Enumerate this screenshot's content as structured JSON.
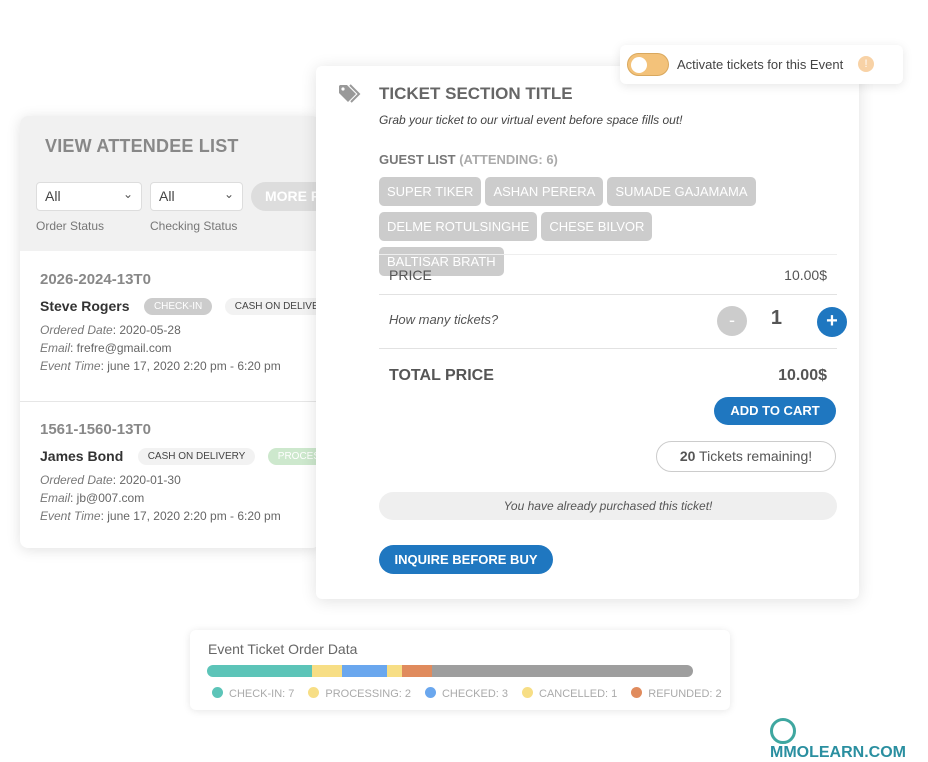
{
  "attendee_list": {
    "title": "VIEW ATTENDEE LIST",
    "filters": [
      {
        "value": "All",
        "label": "Order Status"
      },
      {
        "value": "All",
        "label": "Checking Status"
      }
    ],
    "more_button": "MORE F",
    "entries": [
      {
        "id": "2026-2024-13T0",
        "name": "Steve Rogers",
        "badges": [
          "CHECK-IN",
          "CASH ON DELIVER"
        ],
        "ordered_label": "Ordered Date",
        "ordered": ": 2020-05-28",
        "email_label": "Email",
        "email": ": frefre@gmail.com",
        "time_label": "Event Time",
        "time": ": june 17, 2020 2:20 pm - 6:20 pm"
      },
      {
        "id": "1561-1560-13T0",
        "name": "James Bond",
        "badges": [
          "CASH ON DELIVERY",
          "PROCESSI"
        ],
        "ordered_label": "Ordered Date",
        "ordered": ": 2020-01-30",
        "email_label": "Email",
        "email": ": jb@007.com",
        "time_label": "Event Time",
        "time": ": june 17, 2020 2:20 pm - 6:20 pm"
      }
    ]
  },
  "toggle": {
    "label": "Activate tickets for this Event",
    "on": true,
    "color": "#f3c27a"
  },
  "ticket": {
    "icon": "tags-icon",
    "title": "TICKET SECTION TITLE",
    "subtitle": "Grab your ticket to our virtual event before space fills out!",
    "guest_label": "GUEST LIST",
    "attending": "(ATTENDING: 6)",
    "guests": [
      "SUPER TIKER",
      "ASHAN PERERA",
      "SUMADE GAJAMAMA",
      "DELME ROTULSINGHE",
      "CHESE BILVOR",
      "BALTISAR BRATH"
    ],
    "price_label": "PRICE",
    "price": "10.00$",
    "qty_label": "How many tickets?",
    "qty": "1",
    "minus": "-",
    "plus": "+",
    "total_label": "TOTAL PRICE",
    "total": "10.00$",
    "add_to_cart": "ADD TO CART",
    "remaining_count": "20",
    "remaining_text": " Tickets remaining!",
    "purchased_note": "You have already purchased this ticket!",
    "inquire": "INQUIRE BEFORE BUY",
    "accent": "#1f77c0"
  },
  "order_data": {
    "title": "Event Ticket Order Data",
    "segments": [
      {
        "label": "CHECK-IN: 7",
        "count": 7,
        "color": "#5cc4b8"
      },
      {
        "label": "PROCESSING: 2",
        "count": 2,
        "color": "#f7de85"
      },
      {
        "label": "CHECKED: 3",
        "count": 3,
        "color": "#6aa7ee"
      },
      {
        "label": "CANCELLED: 1",
        "count": 1,
        "color": "#f7de85"
      },
      {
        "label": "REFUNDED: 2",
        "count": 2,
        "color": "#e08b5d"
      }
    ],
    "remainder_color": "#9e9e9e"
  },
  "watermark": "MMOLEARN.COM"
}
